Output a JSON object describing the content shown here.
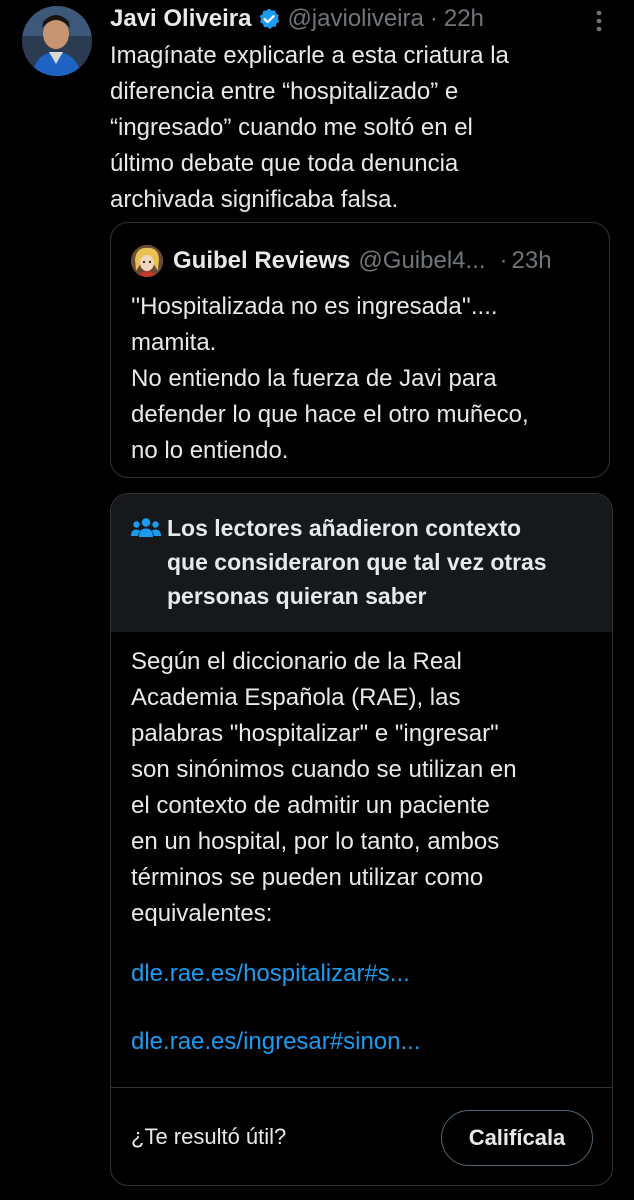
{
  "tweet": {
    "author_name": "Javi Oliveira",
    "handle": "@javioliveira",
    "separator": "·",
    "time": "22h",
    "lines": [
      "Imagínate explicarle a esta criatura la",
      "diferencia entre “hospitalizado” e",
      "“ingresado” cuando me soltó en el",
      "último debate que toda denuncia",
      "archivada significaba falsa."
    ]
  },
  "quote": {
    "author_name": "Guibel Reviews",
    "handle": "@Guibel4...",
    "separator": "·",
    "time": "23h",
    "lines": [
      "''Hospitalizada no es ingresada''....",
      "mamita.",
      "No entiendo la fuerza de Javi para",
      "defender lo que hace el otro muñeco,",
      "no lo entiendo."
    ]
  },
  "note": {
    "title_lines": [
      "Los lectores añadieron contexto",
      "que consideraron que tal vez otras",
      "personas quieran saber"
    ],
    "body_lines": [
      "Según el diccionario de la Real",
      "Academia Española (RAE), las",
      "palabras \"hospitalizar\" e \"ingresar\"",
      "son sinónimos cuando se utilizan en",
      "el contexto de admitir un paciente",
      "en un hospital, por lo tanto, ambos",
      "términos se pueden utilizar como",
      "equivalentes:"
    ],
    "links": [
      "dle.rae.es/hospitalizar#s...",
      "dle.rae.es/ingresar#sinon..."
    ],
    "useful_question": "¿Te resultó útil?",
    "rate_button": "Califícala"
  },
  "icons": {
    "verified": "verified-badge-icon",
    "more": "more-options-icon",
    "note": "people-icon"
  },
  "colors": {
    "background": "#000000",
    "text": "#e7e9ea",
    "secondary": "#71767b",
    "link": "#1d9bf0",
    "verified": "#1d9bf0",
    "note_header_bg": "#16181c",
    "border": "#2f3336"
  }
}
